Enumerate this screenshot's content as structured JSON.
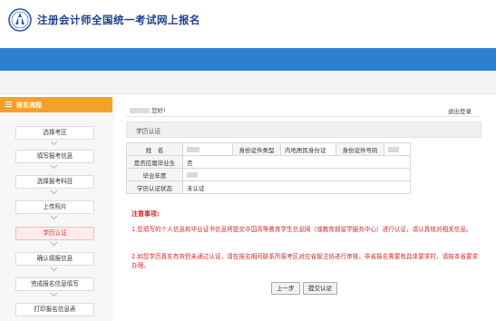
{
  "header": {
    "title": "注册会计师全国统一考试网上报名"
  },
  "sidebar": {
    "title": "报名流程",
    "steps": [
      {
        "label": "选择考区",
        "active": false
      },
      {
        "label": "填写报考信息",
        "active": false
      },
      {
        "label": "选择报考科目",
        "active": false
      },
      {
        "label": "上传照片",
        "active": false
      },
      {
        "label": "学历认证",
        "active": true
      },
      {
        "label": "确认填报信息",
        "active": false
      },
      {
        "label": "完成报名信息填写",
        "active": false
      },
      {
        "label": "打印报名信息表",
        "active": false
      }
    ]
  },
  "main": {
    "greeting": "您好!",
    "logout": "退出登录",
    "section_title": "学历认证",
    "table": {
      "name_label": "姓　名",
      "id_type_label": "身份证件类型",
      "id_type_value": "内地居民身份证",
      "id_number_label": "身份证件号码",
      "graduate_label": "是否应届毕业生",
      "graduate_value": "否",
      "grad_year_label": "毕业年度",
      "cert_status_label": "学历认证状态",
      "cert_status_value": "未认证"
    },
    "notes_title": "注意事项:",
    "note1": "1.您填写的个人信息和毕业证书信息将提交中国高等教育学生信息网（或教育部留学服务中心）进行认证，请认真核对相关信息。",
    "note2": "2.如您学历真实有效但未通过认证，请在报名期间联系所报考区对应省级注协进行审核。非省报名需要有具体要求时，请按本省要求办理。",
    "buttons": {
      "prev": "上一步",
      "submit": "提交认证"
    }
  },
  "colors": {
    "accent_blue": "#2f7fd1",
    "sidebar_orange": "#f2a22a",
    "warning_red": "#d12a2a"
  }
}
